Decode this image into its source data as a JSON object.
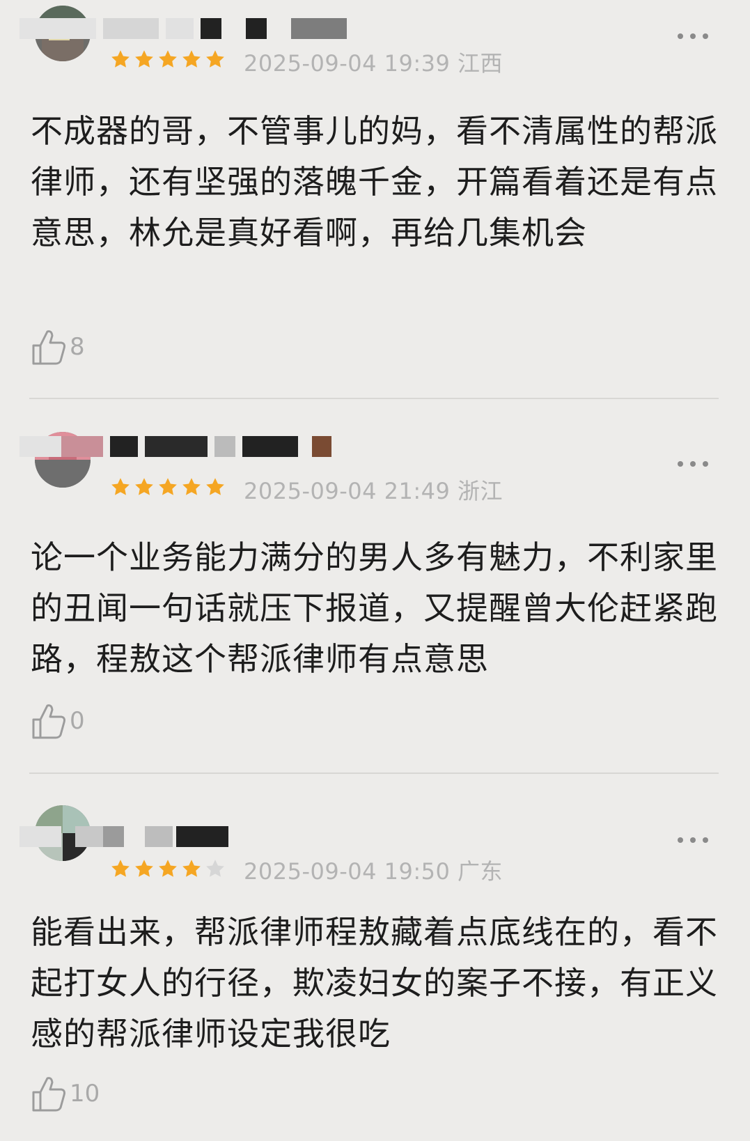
{
  "reviews": [
    {
      "stars": 5,
      "date": "2025-09-04 19:39",
      "region": "江西",
      "text": "不成器的哥，不管事儿的妈，看不清属性的帮派律师，还有坚强的落魄千金，开篇看着还是有点意思，林允是真好看啊，再给几集机会",
      "likes": "8"
    },
    {
      "stars": 5,
      "date": "2025-09-04 21:49",
      "region": "浙江",
      "text": "论一个业务能力满分的男人多有魅力，不利家里的丑闻一句话就压下报道，又提醒曾大伦赶紧跑路，程敖这个帮派律师有点意思",
      "likes": "0"
    },
    {
      "stars": 4,
      "date": "2025-09-04 19:50",
      "region": "广东",
      "text": "能看出来，帮派律师程敖藏着点底线在的，看不起打女人的行径，欺凌妇女的案子不接，有正义感的帮派律师设定我很吃",
      "likes": "10"
    }
  ],
  "colors": {
    "background": "#edecea",
    "star_filled": "#f5a623",
    "star_empty": "#d6d6d6",
    "meta_text": "#b3b3b3",
    "like_count": "#a9a9a9"
  },
  "icons": {
    "like": "thumbs-up-icon",
    "more": "more-dots-icon",
    "star": "star-icon"
  }
}
